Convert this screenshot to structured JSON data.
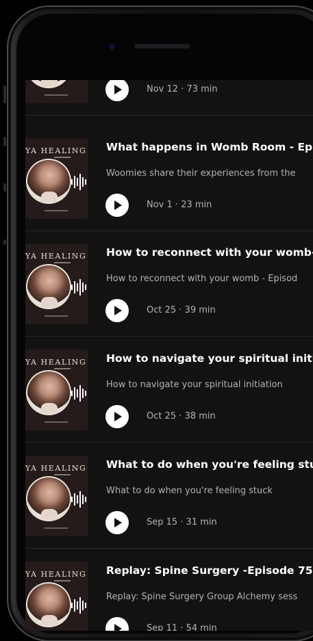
{
  "cover": {
    "brand_text": "IYA HEALING"
  },
  "episodes": [
    {
      "title": "",
      "description": "",
      "date": "Nov 12",
      "duration": "73 min"
    },
    {
      "title": "What happens in Womb Room - Epis",
      "description": "Woomies share their experiences from the",
      "date": "Nov 1",
      "duration": "23 min"
    },
    {
      "title": "How to reconnect with your womb- E",
      "description": "How to reconnect with your womb - Episod",
      "date": "Oct 25",
      "duration": "39 min"
    },
    {
      "title": "How to navigate your spiritual initiat",
      "description": "How to navigate your spiritual initiation",
      "date": "Oct 25",
      "duration": "38 min"
    },
    {
      "title": "What to do when you're feeling stuck",
      "description": "What to do when you're feeling stuck",
      "date": "Sep 15",
      "duration": "31 min"
    },
    {
      "title": "Replay: Spine Surgery -Episode 75",
      "description": "Replay: Spine Surgery Group Alchemy sess",
      "date": "Sep 11",
      "duration": "54 min"
    }
  ],
  "separator": " · ",
  "colors": {
    "background": "#121212",
    "title": "#ffffff",
    "secondary_text": "#b3b3b3",
    "play_button": "#ffffff"
  }
}
